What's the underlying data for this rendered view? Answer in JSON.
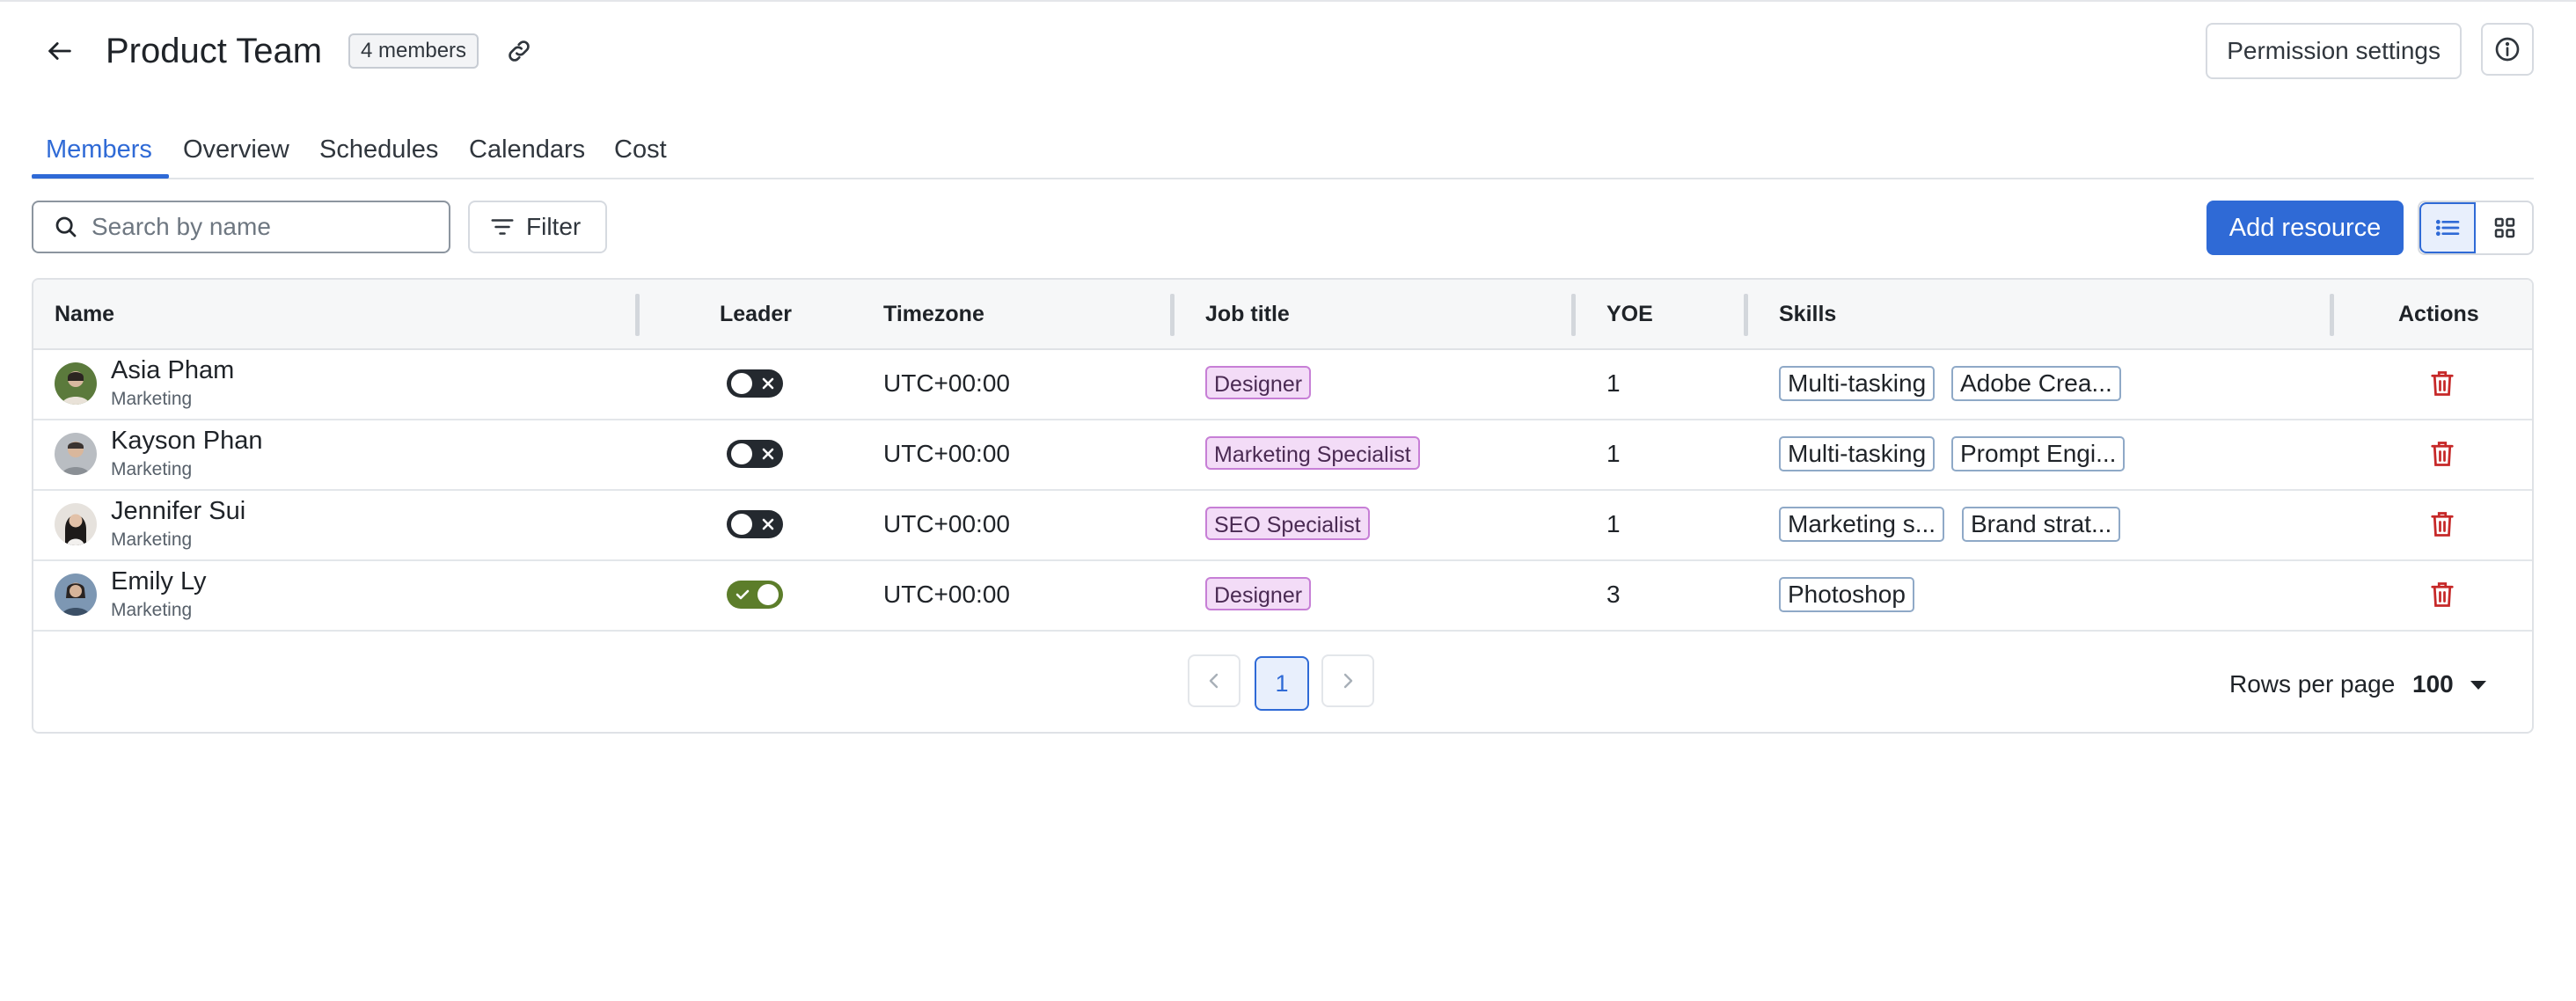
{
  "header": {
    "title": "Product Team",
    "member_badge": "4 members",
    "permission_button": "Permission settings"
  },
  "tabs": [
    {
      "label": "Members",
      "active": true
    },
    {
      "label": "Overview",
      "active": false
    },
    {
      "label": "Schedules",
      "active": false
    },
    {
      "label": "Calendars",
      "active": false
    },
    {
      "label": "Cost",
      "active": false
    }
  ],
  "toolbar": {
    "search_placeholder": "Search by name",
    "search_value": "",
    "filter_label": "Filter",
    "add_button": "Add resource",
    "view_mode": "list"
  },
  "table": {
    "columns": {
      "name": "Name",
      "leader": "Leader",
      "timezone": "Timezone",
      "job_title": "Job title",
      "yoe": "YOE",
      "skills": "Skills",
      "actions": "Actions"
    },
    "rows": [
      {
        "name": "Asia Pham",
        "department": "Marketing",
        "leader": false,
        "timezone": "UTC+00:00",
        "job_title": "Designer",
        "yoe": "1",
        "skills": [
          "Multi-tasking",
          "Adobe Crea..."
        ],
        "avatar_color": "#5b7a3c"
      },
      {
        "name": "Kayson Phan",
        "department": "Marketing",
        "leader": false,
        "timezone": "UTC+00:00",
        "job_title": "Marketing Specialist",
        "yoe": "1",
        "skills": [
          "Multi-tasking",
          "Prompt Engi..."
        ],
        "avatar_color": "#8a8f95"
      },
      {
        "name": "Jennifer Sui",
        "department": "Marketing",
        "leader": false,
        "timezone": "UTC+00:00",
        "job_title": "SEO Specialist",
        "yoe": "1",
        "skills": [
          "Marketing s...",
          "Brand strat..."
        ],
        "avatar_color": "#3a3232"
      },
      {
        "name": "Emily Ly",
        "department": "Marketing",
        "leader": true,
        "timezone": "UTC+00:00",
        "job_title": "Designer",
        "yoe": "3",
        "skills": [
          "Photoshop"
        ],
        "avatar_color": "#4f6f8f"
      }
    ]
  },
  "pagination": {
    "current_page": "1",
    "rows_per_page_label": "Rows per page",
    "rows_per_page_value": "100"
  },
  "colors": {
    "accent": "#2f6ad6",
    "job_tag_bg": "#f3dcf7",
    "job_tag_border": "#c77fd6",
    "leader_on": "#5c7d2a",
    "leader_off": "#24292f",
    "delete": "#c62828"
  }
}
